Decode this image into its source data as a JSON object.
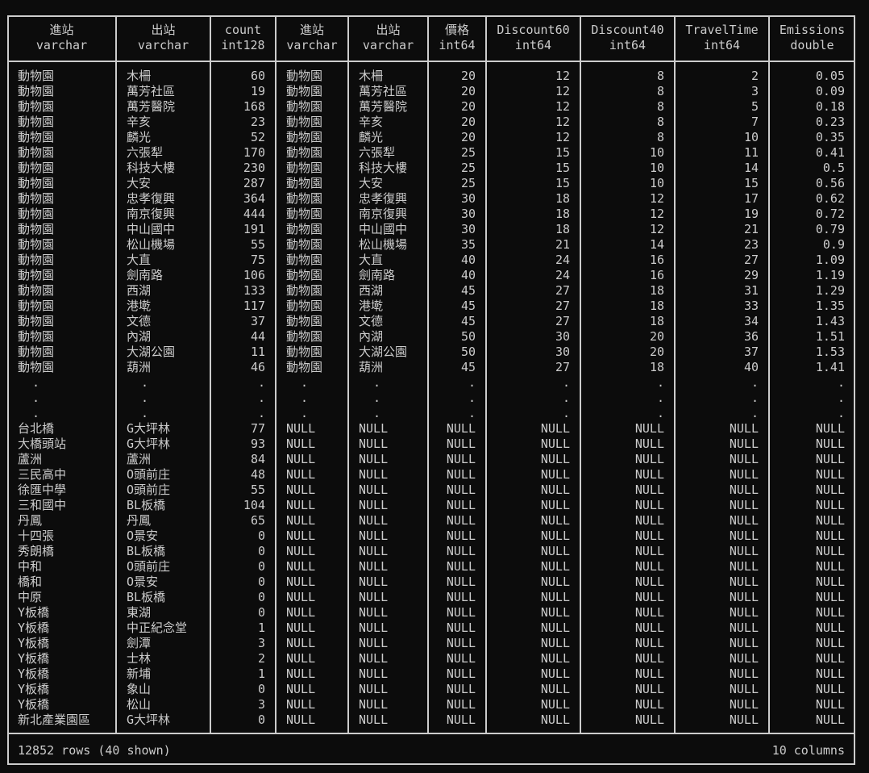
{
  "columns": [
    {
      "name": "進站",
      "type": "varchar",
      "align": "l"
    },
    {
      "name": "出站",
      "type": "varchar",
      "align": "l"
    },
    {
      "name": "count",
      "type": "int128",
      "align": "r"
    },
    {
      "name": "進站",
      "type": "varchar",
      "align": "l"
    },
    {
      "name": "出站",
      "type": "varchar",
      "align": "l"
    },
    {
      "name": "價格",
      "type": "int64",
      "align": "r"
    },
    {
      "name": "Discount60",
      "type": "int64",
      "align": "r"
    },
    {
      "name": "Discount40",
      "type": "int64",
      "align": "r"
    },
    {
      "name": "TravelTime",
      "type": "int64",
      "align": "r"
    },
    {
      "name": "Emissions",
      "type": "double",
      "align": "r"
    }
  ],
  "rows_top": [
    [
      "動物園",
      "木柵",
      "60",
      "動物園",
      "木柵",
      "20",
      "12",
      "8",
      "2",
      "0.05"
    ],
    [
      "動物園",
      "萬芳社區",
      "19",
      "動物園",
      "萬芳社區",
      "20",
      "12",
      "8",
      "3",
      "0.09"
    ],
    [
      "動物園",
      "萬芳醫院",
      "168",
      "動物園",
      "萬芳醫院",
      "20",
      "12",
      "8",
      "5",
      "0.18"
    ],
    [
      "動物園",
      "辛亥",
      "23",
      "動物園",
      "辛亥",
      "20",
      "12",
      "8",
      "7",
      "0.23"
    ],
    [
      "動物園",
      "麟光",
      "52",
      "動物園",
      "麟光",
      "20",
      "12",
      "8",
      "10",
      "0.35"
    ],
    [
      "動物園",
      "六張犁",
      "170",
      "動物園",
      "六張犁",
      "25",
      "15",
      "10",
      "11",
      "0.41"
    ],
    [
      "動物園",
      "科技大樓",
      "230",
      "動物園",
      "科技大樓",
      "25",
      "15",
      "10",
      "14",
      "0.5"
    ],
    [
      "動物園",
      "大安",
      "287",
      "動物園",
      "大安",
      "25",
      "15",
      "10",
      "15",
      "0.56"
    ],
    [
      "動物園",
      "忠孝復興",
      "364",
      "動物園",
      "忠孝復興",
      "30",
      "18",
      "12",
      "17",
      "0.62"
    ],
    [
      "動物園",
      "南京復興",
      "444",
      "動物園",
      "南京復興",
      "30",
      "18",
      "12",
      "19",
      "0.72"
    ],
    [
      "動物園",
      "中山國中",
      "191",
      "動物園",
      "中山國中",
      "30",
      "18",
      "12",
      "21",
      "0.79"
    ],
    [
      "動物園",
      "松山機場",
      "55",
      "動物園",
      "松山機場",
      "35",
      "21",
      "14",
      "23",
      "0.9"
    ],
    [
      "動物園",
      "大直",
      "75",
      "動物園",
      "大直",
      "40",
      "24",
      "16",
      "27",
      "1.09"
    ],
    [
      "動物園",
      "劍南路",
      "106",
      "動物園",
      "劍南路",
      "40",
      "24",
      "16",
      "29",
      "1.19"
    ],
    [
      "動物園",
      "西湖",
      "133",
      "動物園",
      "西湖",
      "45",
      "27",
      "18",
      "31",
      "1.29"
    ],
    [
      "動物園",
      "港墘",
      "117",
      "動物園",
      "港墘",
      "45",
      "27",
      "18",
      "33",
      "1.35"
    ],
    [
      "動物園",
      "文德",
      "37",
      "動物園",
      "文德",
      "45",
      "27",
      "18",
      "34",
      "1.43"
    ],
    [
      "動物園",
      "內湖",
      "44",
      "動物園",
      "內湖",
      "50",
      "30",
      "20",
      "36",
      "1.51"
    ],
    [
      "動物園",
      "大湖公園",
      "11",
      "動物園",
      "大湖公園",
      "50",
      "30",
      "20",
      "37",
      "1.53"
    ],
    [
      "動物園",
      "葫洲",
      "46",
      "動物園",
      "葫洲",
      "45",
      "27",
      "18",
      "40",
      "1.41"
    ]
  ],
  "ellipsis": ".",
  "rows_bottom": [
    [
      "台北橋",
      "G大坪林",
      "77",
      "NULL",
      "NULL",
      "NULL",
      "NULL",
      "NULL",
      "NULL",
      "NULL"
    ],
    [
      "大橋頭站",
      "G大坪林",
      "93",
      "NULL",
      "NULL",
      "NULL",
      "NULL",
      "NULL",
      "NULL",
      "NULL"
    ],
    [
      "蘆洲",
      "蘆洲",
      "84",
      "NULL",
      "NULL",
      "NULL",
      "NULL",
      "NULL",
      "NULL",
      "NULL"
    ],
    [
      "三民高中",
      "O頭前庄",
      "48",
      "NULL",
      "NULL",
      "NULL",
      "NULL",
      "NULL",
      "NULL",
      "NULL"
    ],
    [
      "徐匯中學",
      "O頭前庄",
      "55",
      "NULL",
      "NULL",
      "NULL",
      "NULL",
      "NULL",
      "NULL",
      "NULL"
    ],
    [
      "三和國中",
      "BL板橋",
      "104",
      "NULL",
      "NULL",
      "NULL",
      "NULL",
      "NULL",
      "NULL",
      "NULL"
    ],
    [
      "丹鳳",
      "丹鳳",
      "65",
      "NULL",
      "NULL",
      "NULL",
      "NULL",
      "NULL",
      "NULL",
      "NULL"
    ],
    [
      "十四張",
      "O景安",
      "0",
      "NULL",
      "NULL",
      "NULL",
      "NULL",
      "NULL",
      "NULL",
      "NULL"
    ],
    [
      "秀朗橋",
      "BL板橋",
      "0",
      "NULL",
      "NULL",
      "NULL",
      "NULL",
      "NULL",
      "NULL",
      "NULL"
    ],
    [
      "中和",
      "O頭前庄",
      "0",
      "NULL",
      "NULL",
      "NULL",
      "NULL",
      "NULL",
      "NULL",
      "NULL"
    ],
    [
      "橋和",
      "O景安",
      "0",
      "NULL",
      "NULL",
      "NULL",
      "NULL",
      "NULL",
      "NULL",
      "NULL"
    ],
    [
      "中原",
      "BL板橋",
      "0",
      "NULL",
      "NULL",
      "NULL",
      "NULL",
      "NULL",
      "NULL",
      "NULL"
    ],
    [
      "Y板橋",
      "東湖",
      "0",
      "NULL",
      "NULL",
      "NULL",
      "NULL",
      "NULL",
      "NULL",
      "NULL"
    ],
    [
      "Y板橋",
      "中正紀念堂",
      "1",
      "NULL",
      "NULL",
      "NULL",
      "NULL",
      "NULL",
      "NULL",
      "NULL"
    ],
    [
      "Y板橋",
      "劍潭",
      "3",
      "NULL",
      "NULL",
      "NULL",
      "NULL",
      "NULL",
      "NULL",
      "NULL"
    ],
    [
      "Y板橋",
      "士林",
      "2",
      "NULL",
      "NULL",
      "NULL",
      "NULL",
      "NULL",
      "NULL",
      "NULL"
    ],
    [
      "Y板橋",
      "新埔",
      "1",
      "NULL",
      "NULL",
      "NULL",
      "NULL",
      "NULL",
      "NULL",
      "NULL"
    ],
    [
      "Y板橋",
      "象山",
      "0",
      "NULL",
      "NULL",
      "NULL",
      "NULL",
      "NULL",
      "NULL",
      "NULL"
    ],
    [
      "Y板橋",
      "松山",
      "3",
      "NULL",
      "NULL",
      "NULL",
      "NULL",
      "NULL",
      "NULL",
      "NULL"
    ],
    [
      "新北產業園區",
      "G大坪林",
      "0",
      "NULL",
      "NULL",
      "NULL",
      "NULL",
      "NULL",
      "NULL",
      "NULL"
    ]
  ],
  "footer": {
    "rows_text": "12852 rows (40 shown)",
    "columns_text": "10 columns"
  }
}
